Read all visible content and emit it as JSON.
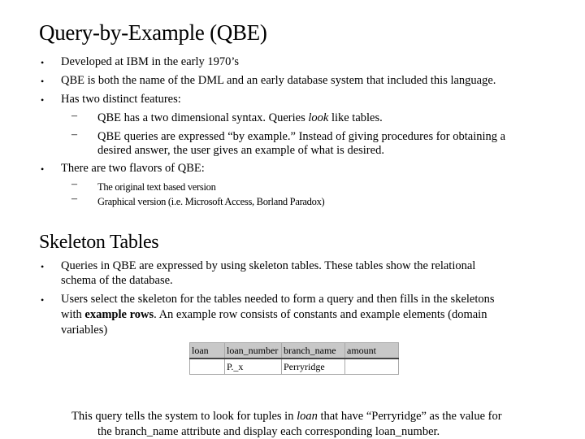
{
  "section1": {
    "title": "Query-by-Example (QBE)",
    "bullets": [
      "Developed at IBM in the early 1970’s",
      "QBE is both the name of the DML and an early database system that included this language.",
      "Has two distinct features:",
      "There are two flavors of QBE:"
    ],
    "features": [
      {
        "before": "QBE has a two dimensional syntax.  Queries ",
        "italic": "look",
        "after": " like tables."
      },
      {
        "line1": "QBE queries are expressed “by example.”  Instead of giving procedures for obtaining a",
        "line2": "desired answer, the user gives an example of what is desired."
      }
    ],
    "flavors": [
      "The original text based version",
      "Graphical version (i.e. Microsoft Access, Borland Paradox)"
    ]
  },
  "section2": {
    "title": "Skeleton Tables",
    "bullet1": {
      "line1": "Queries in QBE are expressed by using skeleton tables. These tables show the relational",
      "line2": "schema of the database."
    },
    "bullet2": {
      "line1": "Users select the skeleton for the tables needed to form a query and then fills in the skeletons",
      "line2_before": "with ",
      "line2_bold": "example rows",
      "line2_after": ".   An example row consists of constants and example elements (domain",
      "line3": "variables)"
    },
    "table": {
      "headers": [
        "loan",
        "loan_number",
        "branch_name",
        "amount"
      ],
      "row": [
        "",
        "P._x",
        "Perryridge",
        ""
      ]
    },
    "caption": {
      "line1_before": "This query tells the system to look for tuples in ",
      "line1_italic": "loan",
      "line1_after": " that have “Perryridge” as the value for",
      "line2": "the  branch_name attribute and display each corresponding loan_number."
    }
  },
  "glyphs": {
    "bullet": "•",
    "dash": "–"
  }
}
